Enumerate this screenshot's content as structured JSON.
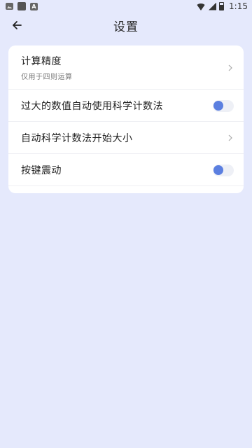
{
  "status_bar": {
    "time": "1:15"
  },
  "header": {
    "title": "设置"
  },
  "settings": {
    "precision": {
      "title": "计算精度",
      "subtitle": "仅用于四则运算"
    },
    "auto_scientific": {
      "title": "过大的数值自动使用科学计数法",
      "enabled": false
    },
    "scientific_threshold": {
      "title": "自动科学计数法开始大小"
    },
    "key_vibration": {
      "title": "按键震动",
      "enabled": false
    }
  },
  "colors": {
    "background": "#e5e9fc",
    "card": "#ffffff",
    "accent": "#5b7fe0"
  }
}
